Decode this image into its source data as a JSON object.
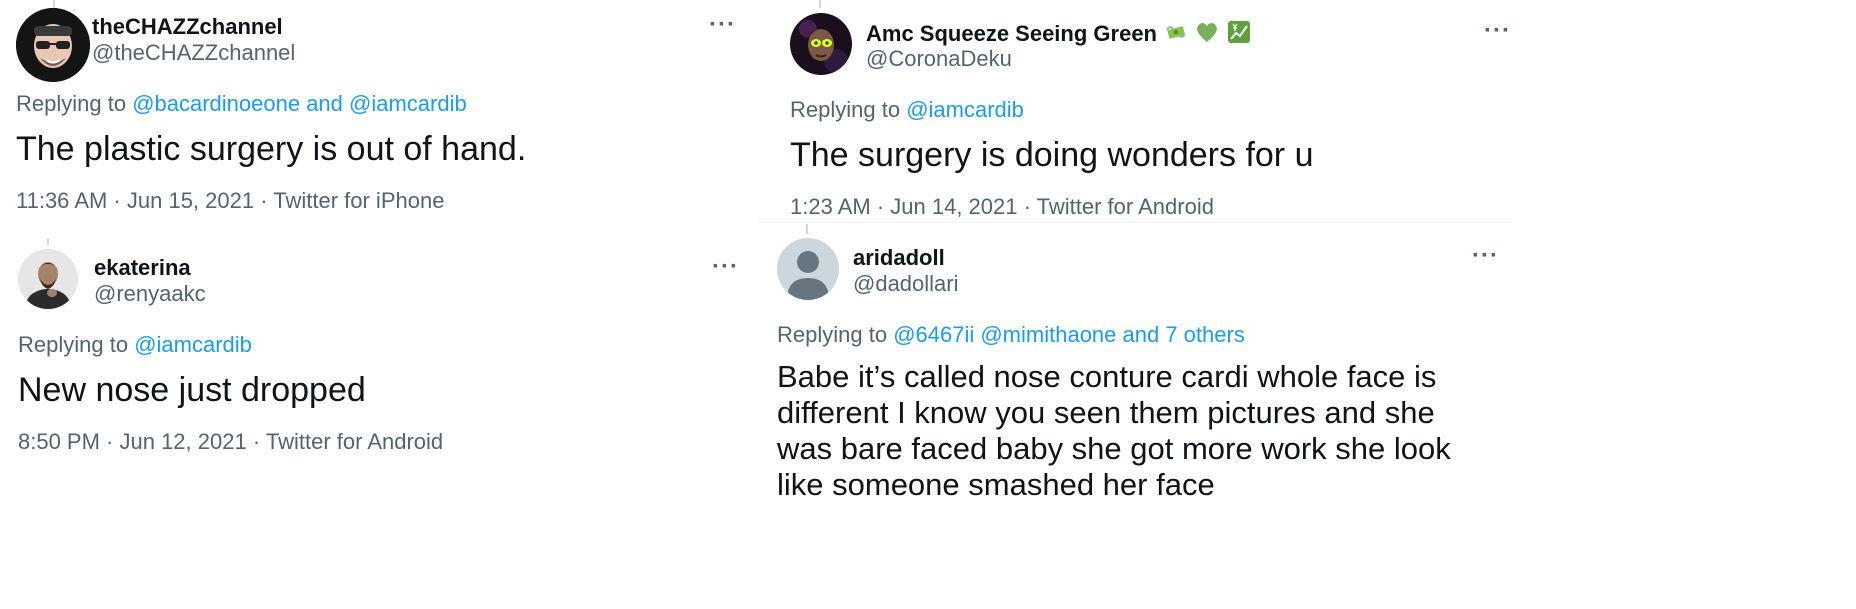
{
  "tweets": [
    {
      "name": "theCHAZZchannel",
      "handle": "@theCHAZZchannel",
      "replying_prefix": "Replying to ",
      "replying_to": "@bacardinoeone and @iamcardib",
      "text": "The plastic surgery is out of hand.",
      "meta": "11:36 AM · Jun 15, 2021 · Twitter for iPhone",
      "more": "···"
    },
    {
      "name": "ekaterina",
      "handle": "@renyaakc",
      "replying_prefix": "Replying to ",
      "replying_to": "@iamcardib",
      "text": "New nose just dropped",
      "meta": "8:50 PM · Jun 12, 2021 · Twitter for Android",
      "more": "···"
    },
    {
      "name": "Amc Squeeze Seeing Green",
      "handle": "@CoronaDeku",
      "replying_prefix": "Replying to ",
      "replying_to": "@iamcardib",
      "text": "The surgery is doing wonders for u",
      "meta": "1:23 AM · Jun 14, 2021 · Twitter for Android",
      "more": "···",
      "name_emojis": [
        "money-with-wings-emoji",
        "green-heart-emoji",
        "yen-chart-emoji"
      ]
    },
    {
      "name": "aridadoll",
      "handle": "@dadollari",
      "replying_prefix": "Replying to ",
      "replying_to": "@6467ii @mimithaone and 7 others",
      "text": "Babe it’s called nose conture cardi whole face is different I know you seen them pictures and she was bare faced baby she got more work she look like someone smashed her face",
      "more": "···"
    }
  ],
  "colors": {
    "text": "#0f1419",
    "secondary": "#536471",
    "link": "#1d9bf0",
    "thread_line": "#cfd9de"
  }
}
